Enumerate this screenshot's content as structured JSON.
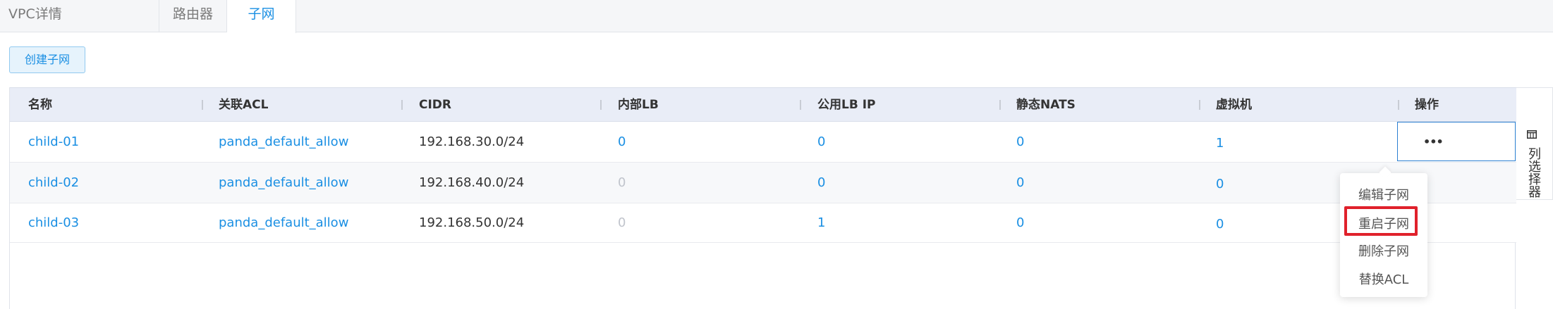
{
  "tabs": [
    {
      "label": "VPC详情"
    },
    {
      "label": "路由器"
    },
    {
      "label": "子网"
    }
  ],
  "create_button": {
    "label": "创建子网"
  },
  "table": {
    "columns": [
      "名称",
      "关联ACL",
      "CIDR",
      "内部LB",
      "公用LB IP",
      "静态NATS",
      "虚拟机",
      "操作"
    ],
    "rows": [
      {
        "name": "child-01",
        "acl": "panda_default_allow",
        "cidr": "192.168.30.0/24",
        "internal_lb": "0",
        "public_lb_ip": "0",
        "static_nats": "0",
        "vms": "1"
      },
      {
        "name": "child-02",
        "acl": "panda_default_allow",
        "cidr": "192.168.40.0/24",
        "internal_lb": "0",
        "public_lb_ip": "0",
        "static_nats": "0",
        "vms": "0"
      },
      {
        "name": "child-03",
        "acl": "panda_default_allow",
        "cidr": "192.168.50.0/24",
        "internal_lb": "0",
        "public_lb_ip": "1",
        "static_nats": "0",
        "vms": "0"
      }
    ],
    "ops_trigger": "•••"
  },
  "column_selector": {
    "label": "列选择器",
    "icon": "columns-icon"
  },
  "dropdown": {
    "items": [
      "编辑子网",
      "重启子网",
      "删除子网",
      "替换ACL"
    ],
    "highlighted_index": 1
  },
  "colors": {
    "accent": "#1a8fe3",
    "highlight": "#e0212b",
    "header_bg": "#e9edf7"
  }
}
